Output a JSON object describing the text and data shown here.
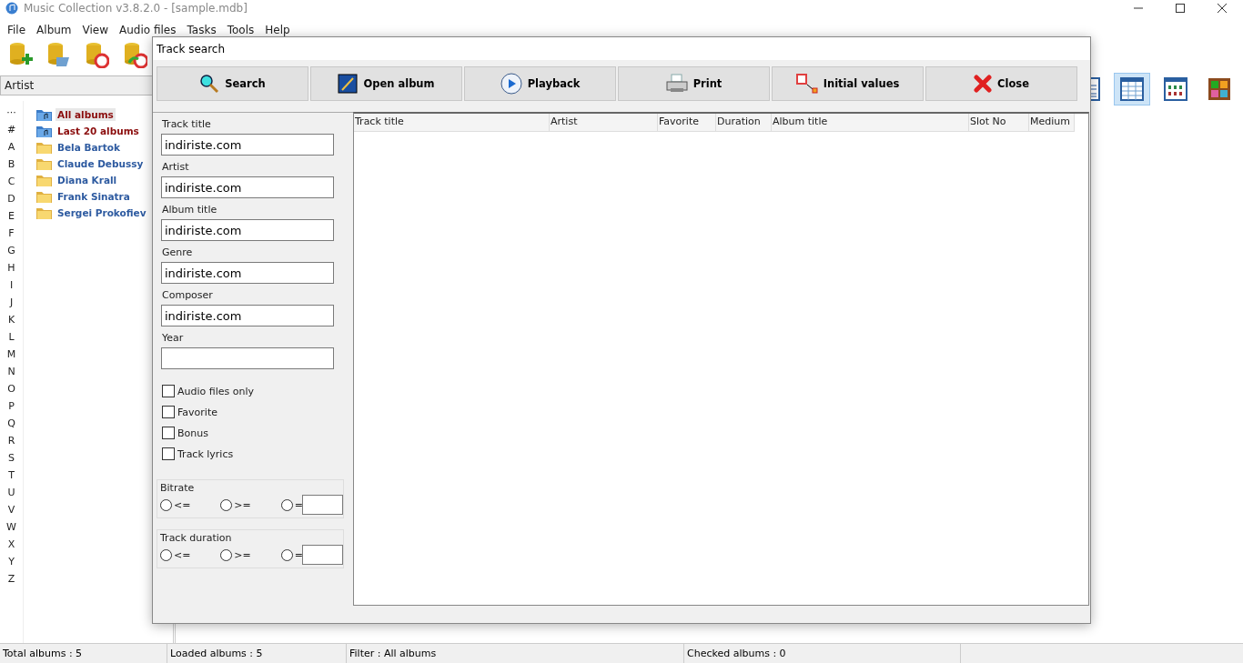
{
  "window": {
    "title": "Music Collection v3.8.2.0 - [sample.mdb]"
  },
  "menu": [
    "File",
    "Album",
    "View",
    "Audio files",
    "Tasks",
    "Tools",
    "Help"
  ],
  "toolbar": [
    {
      "kind": "add"
    },
    {
      "kind": "open"
    },
    {
      "kind": "repair"
    },
    {
      "kind": "restore"
    }
  ],
  "artist_filter": {
    "value": "Artist"
  },
  "index_letters": [
    "···",
    "#",
    "A",
    "B",
    "C",
    "D",
    "E",
    "F",
    "G",
    "H",
    "I",
    "J",
    "K",
    "L",
    "M",
    "N",
    "O",
    "P",
    "Q",
    "R",
    "S",
    "T",
    "U",
    "V",
    "W",
    "X",
    "Y",
    "Z"
  ],
  "tree": [
    {
      "label": "All albums",
      "kind": "special",
      "selected": true
    },
    {
      "label": "Last 20 albums",
      "kind": "special",
      "selected": false
    },
    {
      "label": "Bela Bartok",
      "kind": "artist",
      "selected": false
    },
    {
      "label": "Claude Debussy",
      "kind": "artist",
      "selected": false
    },
    {
      "label": "Diana Krall",
      "kind": "artist",
      "selected": false
    },
    {
      "label": "Frank Sinatra",
      "kind": "artist",
      "selected": false
    },
    {
      "label": "Sergei Prokofiev",
      "kind": "artist",
      "selected": false
    }
  ],
  "view_buttons": [
    {
      "kind": "details",
      "selected": false
    },
    {
      "kind": "table",
      "selected": true
    },
    {
      "kind": "grid",
      "selected": false
    },
    {
      "kind": "shelf",
      "selected": false
    }
  ],
  "dialog": {
    "title": "Track search",
    "buttons": [
      {
        "label": "Search",
        "kind": "search"
      },
      {
        "label": "Open album",
        "kind": "open"
      },
      {
        "label": "Playback",
        "kind": "play"
      },
      {
        "label": "Print",
        "kind": "print"
      },
      {
        "label": "Initial values",
        "kind": "reset"
      },
      {
        "label": "Close",
        "kind": "close"
      }
    ],
    "fields": [
      {
        "label": "Track title",
        "value": "indiriste.com"
      },
      {
        "label": "Artist",
        "value": "indiriste.com"
      },
      {
        "label": "Album title",
        "value": "indiriste.com"
      },
      {
        "label": "Genre",
        "value": "indiriste.com"
      },
      {
        "label": "Composer",
        "value": "indiriste.com"
      },
      {
        "label": "Year"
      }
    ],
    "checkboxes": [
      {
        "label": "Audio files only",
        "checked": false
      },
      {
        "label": "Favorite",
        "checked": false
      },
      {
        "label": "Bonus",
        "checked": false
      },
      {
        "label": "Track lyrics",
        "checked": false
      }
    ],
    "ranges": [
      {
        "title": "Bitrate",
        "options": [
          {
            "label": "<=",
            "selected": false
          },
          {
            "label": ">=",
            "selected": false
          },
          {
            "label": "=",
            "selected": false
          }
        ]
      },
      {
        "title": "Track duration",
        "options": [
          {
            "label": "<=",
            "selected": false
          },
          {
            "label": ">=",
            "selected": false
          },
          {
            "label": "=",
            "selected": false
          }
        ]
      }
    ],
    "table": {
      "columns": [
        "Track title",
        "Artist",
        "Favorite",
        "Duration",
        "Album title",
        "Slot No",
        "Medium"
      ]
    }
  },
  "status_bar": [
    "Total albums : 5",
    "Loaded albums : 5",
    "Filter : All albums",
    "Checked albums : 0"
  ]
}
